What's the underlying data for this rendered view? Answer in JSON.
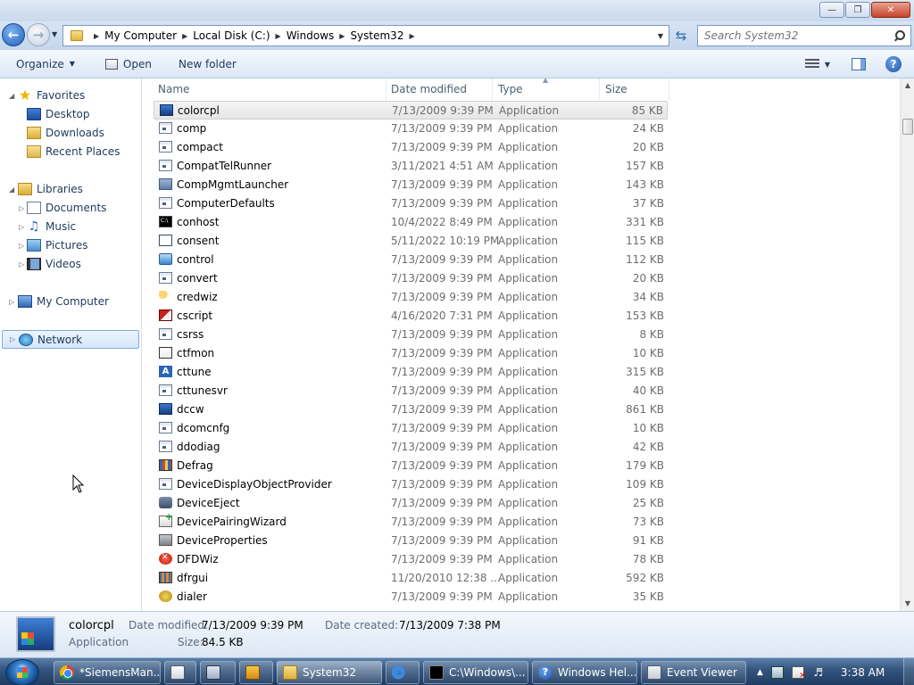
{
  "window": {
    "minimize_label": "—",
    "maximize_label": "❐",
    "close_label": "✕"
  },
  "address": {
    "breadcrumbs": [
      "My Computer",
      "Local Disk (C:)",
      "Windows",
      "System32"
    ],
    "search_placeholder": "Search System32"
  },
  "toolbar": {
    "organize_label": "Organize",
    "open_label": "Open",
    "newfolder_label": "New folder"
  },
  "nav": {
    "favorites": "Favorites",
    "desktop": "Desktop",
    "downloads": "Downloads",
    "recent_places": "Recent Places",
    "libraries": "Libraries",
    "documents": "Documents",
    "music": "Music",
    "pictures": "Pictures",
    "videos": "Videos",
    "my_computer": "My Computer",
    "network": "Network"
  },
  "columns": {
    "name": "Name",
    "date": "Date modified",
    "type": "Type",
    "size": "Size"
  },
  "files": [
    {
      "name": "colorcpl",
      "date": "7/13/2009 9:39 PM",
      "type": "Application",
      "size": "85 KB",
      "icon": "monitor-icon"
    },
    {
      "name": "comp",
      "date": "7/13/2009 9:39 PM",
      "type": "Application",
      "size": "24 KB",
      "icon": "app-icon"
    },
    {
      "name": "compact",
      "date": "7/13/2009 9:39 PM",
      "type": "Application",
      "size": "20 KB",
      "icon": "app-icon"
    },
    {
      "name": "CompatTelRunner",
      "date": "3/11/2021 4:51 AM",
      "type": "Application",
      "size": "157 KB",
      "icon": "app-icon"
    },
    {
      "name": "CompMgmtLauncher",
      "date": "7/13/2009 9:39 PM",
      "type": "Application",
      "size": "143 KB",
      "icon": "computer-management-icon"
    },
    {
      "name": "ComputerDefaults",
      "date": "7/13/2009 9:39 PM",
      "type": "Application",
      "size": "37 KB",
      "icon": "app-icon"
    },
    {
      "name": "conhost",
      "date": "10/4/2022 8:49 PM",
      "type": "Application",
      "size": "331 KB",
      "icon": "console-icon"
    },
    {
      "name": "consent",
      "date": "5/11/2022 10:19 PM",
      "type": "Application",
      "size": "115 KB",
      "icon": "blank-window-icon"
    },
    {
      "name": "control",
      "date": "7/13/2009 9:39 PM",
      "type": "Application",
      "size": "112 KB",
      "icon": "control-panel-icon"
    },
    {
      "name": "convert",
      "date": "7/13/2009 9:39 PM",
      "type": "Application",
      "size": "20 KB",
      "icon": "app-icon"
    },
    {
      "name": "credwiz",
      "date": "7/13/2009 9:39 PM",
      "type": "Application",
      "size": "34 KB",
      "icon": "key-icon"
    },
    {
      "name": "cscript",
      "date": "4/16/2020 7:31 PM",
      "type": "Application",
      "size": "153 KB",
      "icon": "script-icon"
    },
    {
      "name": "csrss",
      "date": "7/13/2009 9:39 PM",
      "type": "Application",
      "size": "8 KB",
      "icon": "app-icon"
    },
    {
      "name": "ctfmon",
      "date": "7/13/2009 9:39 PM",
      "type": "Application",
      "size": "10 KB",
      "icon": "pen-icon"
    },
    {
      "name": "cttune",
      "date": "7/13/2009 9:39 PM",
      "type": "Application",
      "size": "315 KB",
      "icon": "font-icon"
    },
    {
      "name": "cttunesvr",
      "date": "7/13/2009 9:39 PM",
      "type": "Application",
      "size": "40 KB",
      "icon": "app-icon"
    },
    {
      "name": "dccw",
      "date": "7/13/2009 9:39 PM",
      "type": "Application",
      "size": "861 KB",
      "icon": "monitor-icon"
    },
    {
      "name": "dcomcnfg",
      "date": "7/13/2009 9:39 PM",
      "type": "Application",
      "size": "10 KB",
      "icon": "app-icon"
    },
    {
      "name": "ddodiag",
      "date": "7/13/2009 9:39 PM",
      "type": "Application",
      "size": "42 KB",
      "icon": "app-icon"
    },
    {
      "name": "Defrag",
      "date": "7/13/2009 9:39 PM",
      "type": "Application",
      "size": "179 KB",
      "icon": "defrag-icon"
    },
    {
      "name": "DeviceDisplayObjectProvider",
      "date": "7/13/2009 9:39 PM",
      "type": "Application",
      "size": "109 KB",
      "icon": "app-icon"
    },
    {
      "name": "DeviceEject",
      "date": "7/13/2009 9:39 PM",
      "type": "Application",
      "size": "25 KB",
      "icon": "eject-icon"
    },
    {
      "name": "DevicePairingWizard",
      "date": "7/13/2009 9:39 PM",
      "type": "Application",
      "size": "73 KB",
      "icon": "device-pairing-icon"
    },
    {
      "name": "DeviceProperties",
      "date": "7/13/2009 9:39 PM",
      "type": "Application",
      "size": "91 KB",
      "icon": "device-properties-icon"
    },
    {
      "name": "DFDWiz",
      "date": "7/13/2009 9:39 PM",
      "type": "Application",
      "size": "78 KB",
      "icon": "error-icon"
    },
    {
      "name": "dfrgui",
      "date": "11/20/2010 12:38 ...",
      "type": "Application",
      "size": "592 KB",
      "icon": "defrag-gui-icon"
    },
    {
      "name": "dialer",
      "date": "7/13/2009 9:39 PM",
      "type": "Application",
      "size": "35 KB",
      "icon": "dialer-icon"
    }
  ],
  "details": {
    "name": "colorcpl",
    "kind": "Application",
    "date_modified_label": "Date modified:",
    "date_modified": "7/13/2009 9:39 PM",
    "date_created_label": "Date created:",
    "date_created": "7/13/2009 7:38 PM",
    "size_label": "Size:",
    "size": "84.5 KB"
  },
  "taskbar": {
    "items": [
      "*SiemensMan...",
      "",
      "",
      "",
      "System32",
      "",
      "C:\\Windows\\...",
      "Windows Hel...",
      "Event Viewer"
    ],
    "clock": "3:38 AM"
  }
}
